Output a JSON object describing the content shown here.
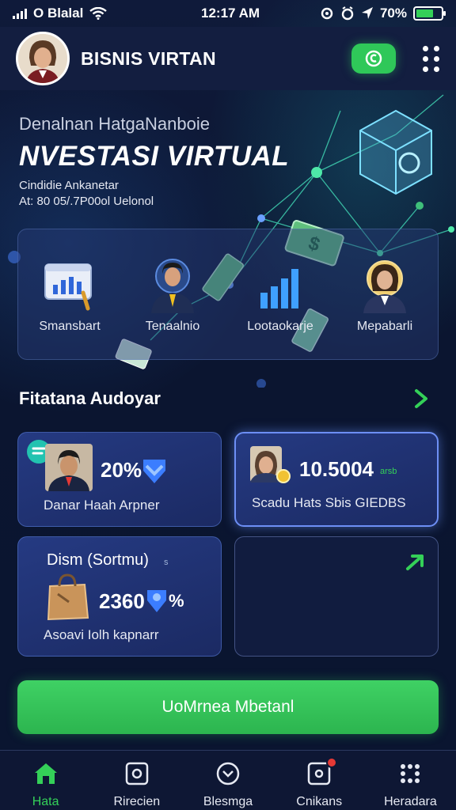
{
  "status_bar": {
    "carrier": "O Blalal",
    "time": "12:17 AM",
    "battery": "70%",
    "battery_fill": 0.7
  },
  "header": {
    "app_title": "BISNIS VIRTAN"
  },
  "hero": {
    "subtitle": "Denalnan HatgaNanboie",
    "title": "NVESTASI VIRTUAL",
    "line1": "Cindidie Ankanetar",
    "line2": "At: 80 05/.7P00ol Uelonol"
  },
  "features": [
    {
      "label": "Smansbart",
      "icon": "bar-chart-icon"
    },
    {
      "label": "Tenaalnio",
      "icon": "businessman-icon"
    },
    {
      "label": "Lootaokarje",
      "icon": "growth-chart-icon"
    },
    {
      "label": "Mepabarli",
      "icon": "businesswoman-icon"
    }
  ],
  "section": {
    "title": "Fitatana Audoyar"
  },
  "cards": {
    "card1": {
      "value": "20%",
      "text": "Danar Haah Arpner"
    },
    "card2": {
      "value": "10.5004",
      "suffix": "arsb",
      "text": "Scadu Hats Sbis GIEDBS"
    },
    "card3": {
      "heading": "Dism (Sortmu)",
      "heading_suffix": "s",
      "value": "2360",
      "value_suffix": "%",
      "text": "Asoavi Iolh kapnarr"
    }
  },
  "cta": {
    "label": "UoMrnea Mbetanl"
  },
  "bottom_nav": [
    {
      "label": "Hata",
      "icon": "home-icon",
      "active": true
    },
    {
      "label": "Rirecien",
      "icon": "square-dot-icon",
      "active": false
    },
    {
      "label": "Blesmga",
      "icon": "circle-chevron-icon",
      "active": false
    },
    {
      "label": "Cnikans",
      "icon": "notification-square-icon",
      "active": false,
      "badge": true
    },
    {
      "label": "Heradara",
      "icon": "grid-dots-icon",
      "active": false
    }
  ],
  "colors": {
    "accent_green": "#34d058",
    "background": "#0c1631",
    "card_blue": "#253a82"
  }
}
